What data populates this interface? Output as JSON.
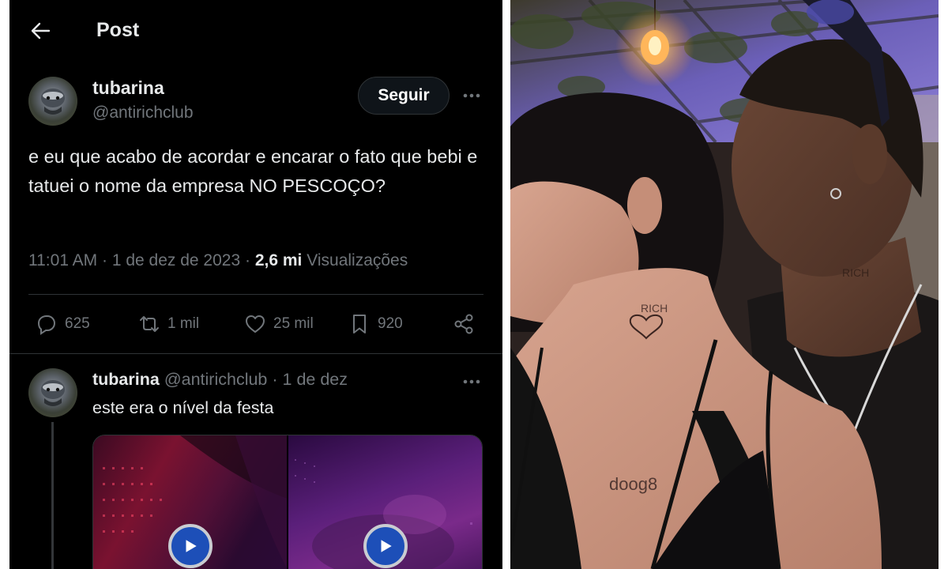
{
  "topbar": {
    "title": "Post"
  },
  "post": {
    "author_name": "tubarina",
    "author_handle": "@antirichclub",
    "follow_label": "Seguir",
    "text": "e eu que acabo de acordar e encarar o fato que bebi e tatuei o nome da empresa NO PESCOÇO?",
    "time": "11:01 AM",
    "date": "1 de dez de 2023",
    "views_count": "2,6 mi",
    "views_label": "Visualizações"
  },
  "actions": {
    "replies": "625",
    "reposts": "1 mil",
    "likes": "25 mil",
    "bookmarks": "920"
  },
  "reply": {
    "author_name": "tubarina",
    "author_handle": "@antirichclub",
    "date": "1 de dez",
    "text": "este era o nível da festa"
  },
  "icons": {
    "back": "arrow-left-icon",
    "more": "ellipsis-icon",
    "reply": "comment-icon",
    "repost": "repost-icon",
    "like": "heart-icon",
    "bookmark": "bookmark-icon",
    "share": "share-icon",
    "play": "play-icon"
  },
  "colors": {
    "background": "#000000",
    "primary_text": "#e7e9ea",
    "secondary_text": "#71767b",
    "divider": "#2f3336",
    "play_button": "#1d4fb8"
  }
}
